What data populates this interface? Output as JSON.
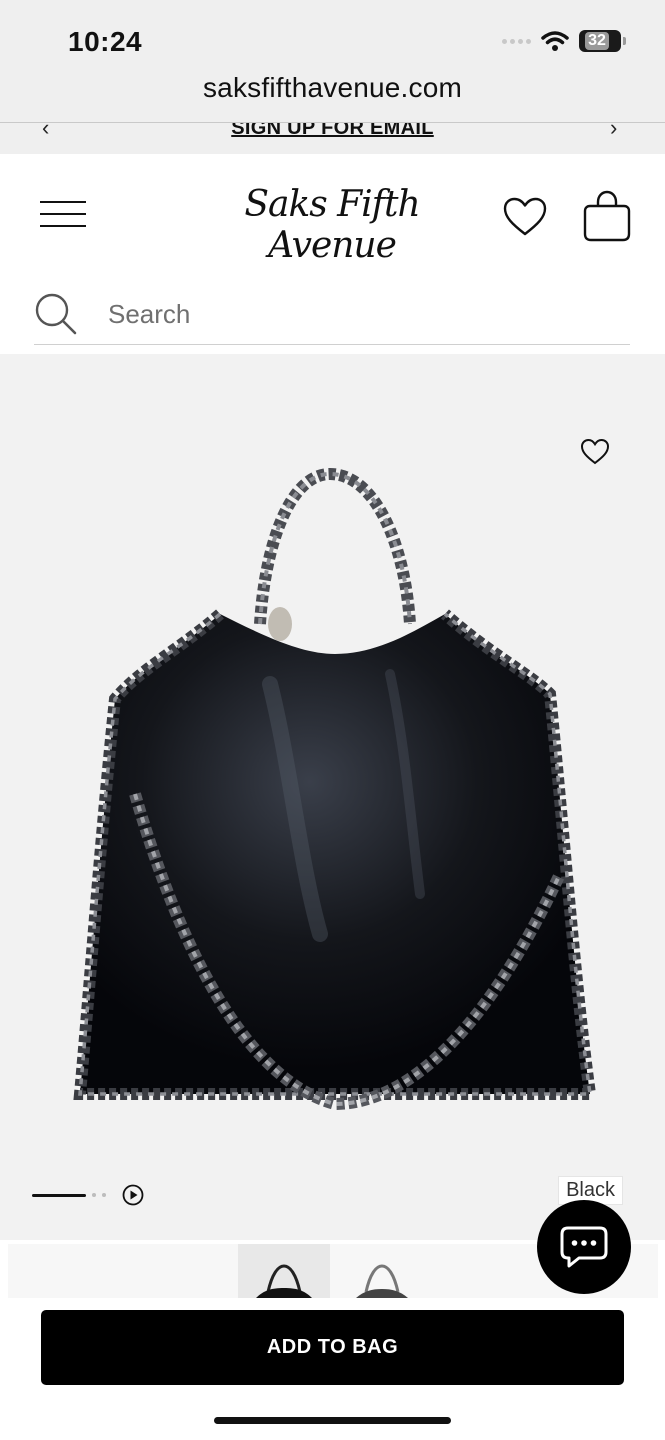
{
  "status_bar": {
    "time": "10:24",
    "battery": "32"
  },
  "browser": {
    "url": "saksfifthavenue.com"
  },
  "promo": {
    "text": "SIGN UP FOR EMAIL",
    "prev": "‹",
    "next": "›"
  },
  "header": {
    "logo": "Saks Fifth Avenue"
  },
  "search": {
    "placeholder": "Search"
  },
  "product": {
    "color": "Black"
  },
  "cta": {
    "add_to_bag": "ADD TO BAG"
  },
  "colors": {
    "accent": "#000000",
    "background": "#f2f2f2"
  }
}
